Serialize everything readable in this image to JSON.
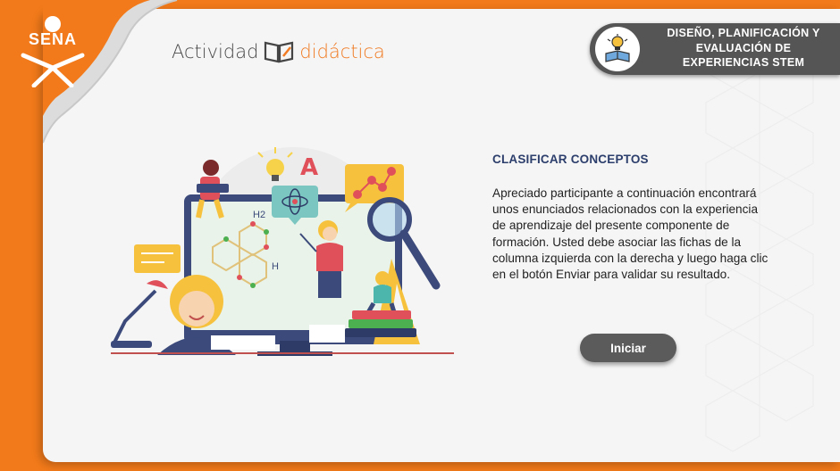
{
  "brand": {
    "logo_text": "SENA"
  },
  "activity": {
    "word1": "Actividad",
    "word2": "didáctica"
  },
  "badge": {
    "line1": "DISEÑO, PLANIFICACIÓN Y",
    "line2": "EVALUACIÓN DE",
    "line3": "EXPERIENCIAS STEM"
  },
  "illustration": {
    "h2_label": "H2",
    "h_label": "H",
    "a_label": "A"
  },
  "content": {
    "heading": "CLASIFICAR CONCEPTOS",
    "body": "Apreciado participante a continuación encontrará unos enunciados relacionados con la experiencia de aprendizaje del presente componente de formación. Usted debe asociar las fichas de la columna izquierda con la derecha y luego haga clic en el botón Enviar para validar su resultado."
  },
  "actions": {
    "start_label": "Iniciar"
  },
  "colors": {
    "orange": "#f27a1a",
    "card": "#f5f5f5",
    "badge": "#555555",
    "heading": "#2c3e6b"
  }
}
